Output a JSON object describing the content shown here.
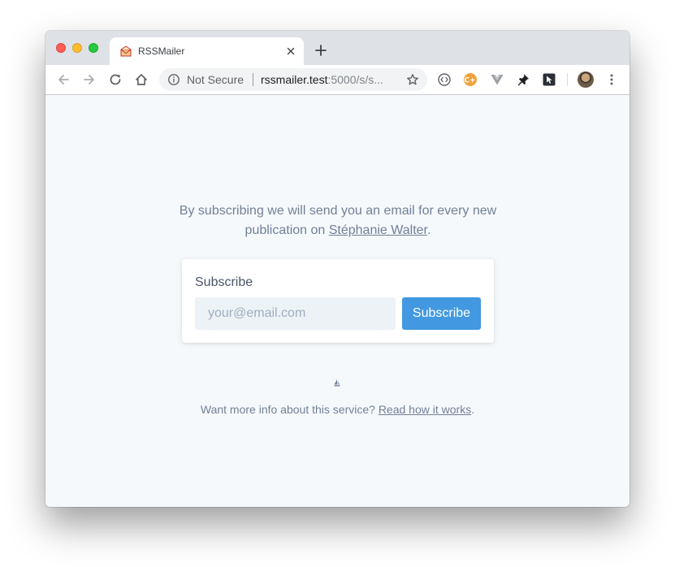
{
  "browser": {
    "tab": {
      "title": "RSSMailer",
      "favicon": "envelope-icon"
    },
    "omnibox": {
      "security_label": "Not Secure",
      "url_host": "rssmailer.test",
      "url_rest": ":5000/s/s..."
    },
    "extensions": [
      "code-extension-icon",
      "cplus-extension-icon",
      "vue-extension-icon",
      "pin-extension-icon",
      "cursor-extension-icon"
    ]
  },
  "page": {
    "intro_prefix": "By subscribing we will send you an email for every new publication on ",
    "intro_link": "Stéphanie Walter",
    "intro_suffix": ".",
    "card": {
      "title": "Subscribe",
      "email_placeholder": "your@email.com",
      "button_label": "Subscribe"
    },
    "footer_prefix": "Want more info about this service? ",
    "footer_link": "Read how it works",
    "footer_suffix": "."
  },
  "colors": {
    "accent": "#4299e1",
    "page_background": "#f6f9fc",
    "text_muted": "#718096"
  }
}
